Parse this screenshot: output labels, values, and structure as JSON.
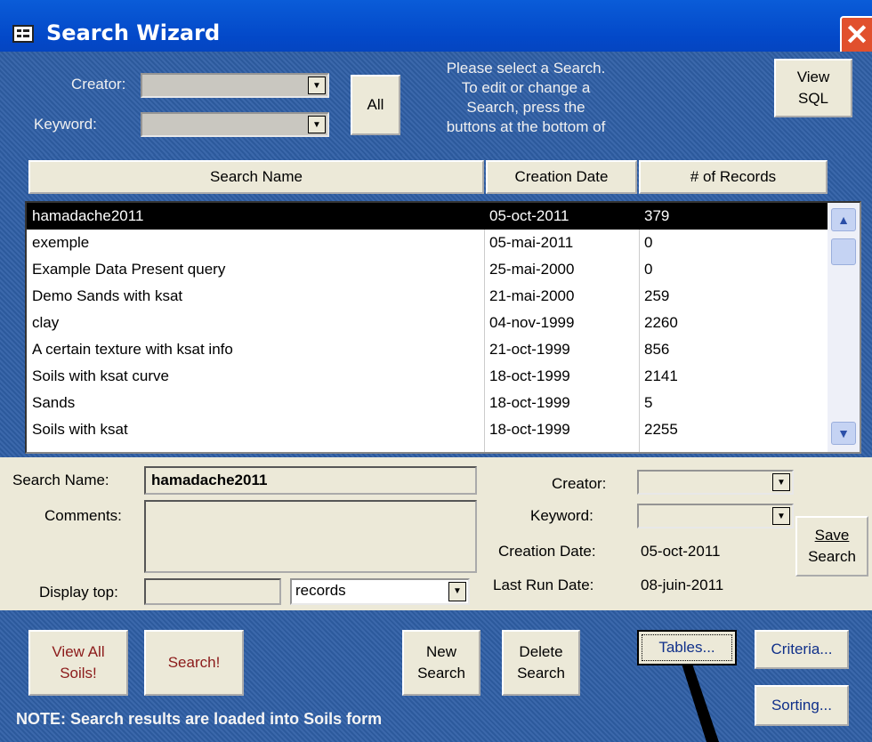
{
  "window": {
    "title": "Search Wizard",
    "title_icon": "form-icon",
    "close_icon": "close-icon"
  },
  "filter": {
    "creator_label": "Creator:",
    "keyword_label": "Keyword:",
    "all_button": "All",
    "info_lines": [
      "Please select a Search.",
      "To edit or change a",
      "Search, press the",
      "buttons at the bottom of"
    ],
    "view_sql_line1": "View",
    "view_sql_line2": "SQL"
  },
  "list": {
    "columns": [
      "Search Name",
      "Creation Date",
      "# of Records"
    ],
    "rows": [
      {
        "name": "hamadache2011",
        "date": "05-oct-2011",
        "records": "379"
      },
      {
        "name": "exemple",
        "date": "05-mai-2011",
        "records": "0"
      },
      {
        "name": "Example Data Present query",
        "date": "25-mai-2000",
        "records": "0"
      },
      {
        "name": "Demo Sands with ksat",
        "date": "21-mai-2000",
        "records": "259"
      },
      {
        "name": "clay",
        "date": "04-nov-1999",
        "records": "2260"
      },
      {
        "name": "A certain texture with ksat info",
        "date": "21-oct-1999",
        "records": "856"
      },
      {
        "name": "Soils with ksat curve",
        "date": "18-oct-1999",
        "records": "2141"
      },
      {
        "name": "Sands",
        "date": "18-oct-1999",
        "records": "5"
      },
      {
        "name": "Soils with ksat",
        "date": "18-oct-1999",
        "records": "2255"
      }
    ],
    "selected_index": 0
  },
  "detail": {
    "search_name_label": "Search Name:",
    "search_name_value": "hamadache2011",
    "comments_label": "Comments:",
    "display_top_label": "Display top:",
    "records_option": "records",
    "creator_label": "Creator:",
    "keyword_label": "Keyword:",
    "creation_date_label": "Creation Date:",
    "creation_date_value": "05-oct-2011",
    "last_run_label": "Last Run Date:",
    "last_run_value": "08-juin-2011",
    "save_line1": "Save",
    "save_line2": "Search"
  },
  "buttons": {
    "view_all_line1": "View All",
    "view_all_line2": "Soils!",
    "search": "Search!",
    "new_line1": "New",
    "new_line2": "Search",
    "delete_line1": "Delete",
    "delete_line2": "Search",
    "tables": "Tables...",
    "criteria": "Criteria...",
    "sorting": "Sorting..."
  },
  "note": "NOTE: Search results are loaded into Soils form"
}
